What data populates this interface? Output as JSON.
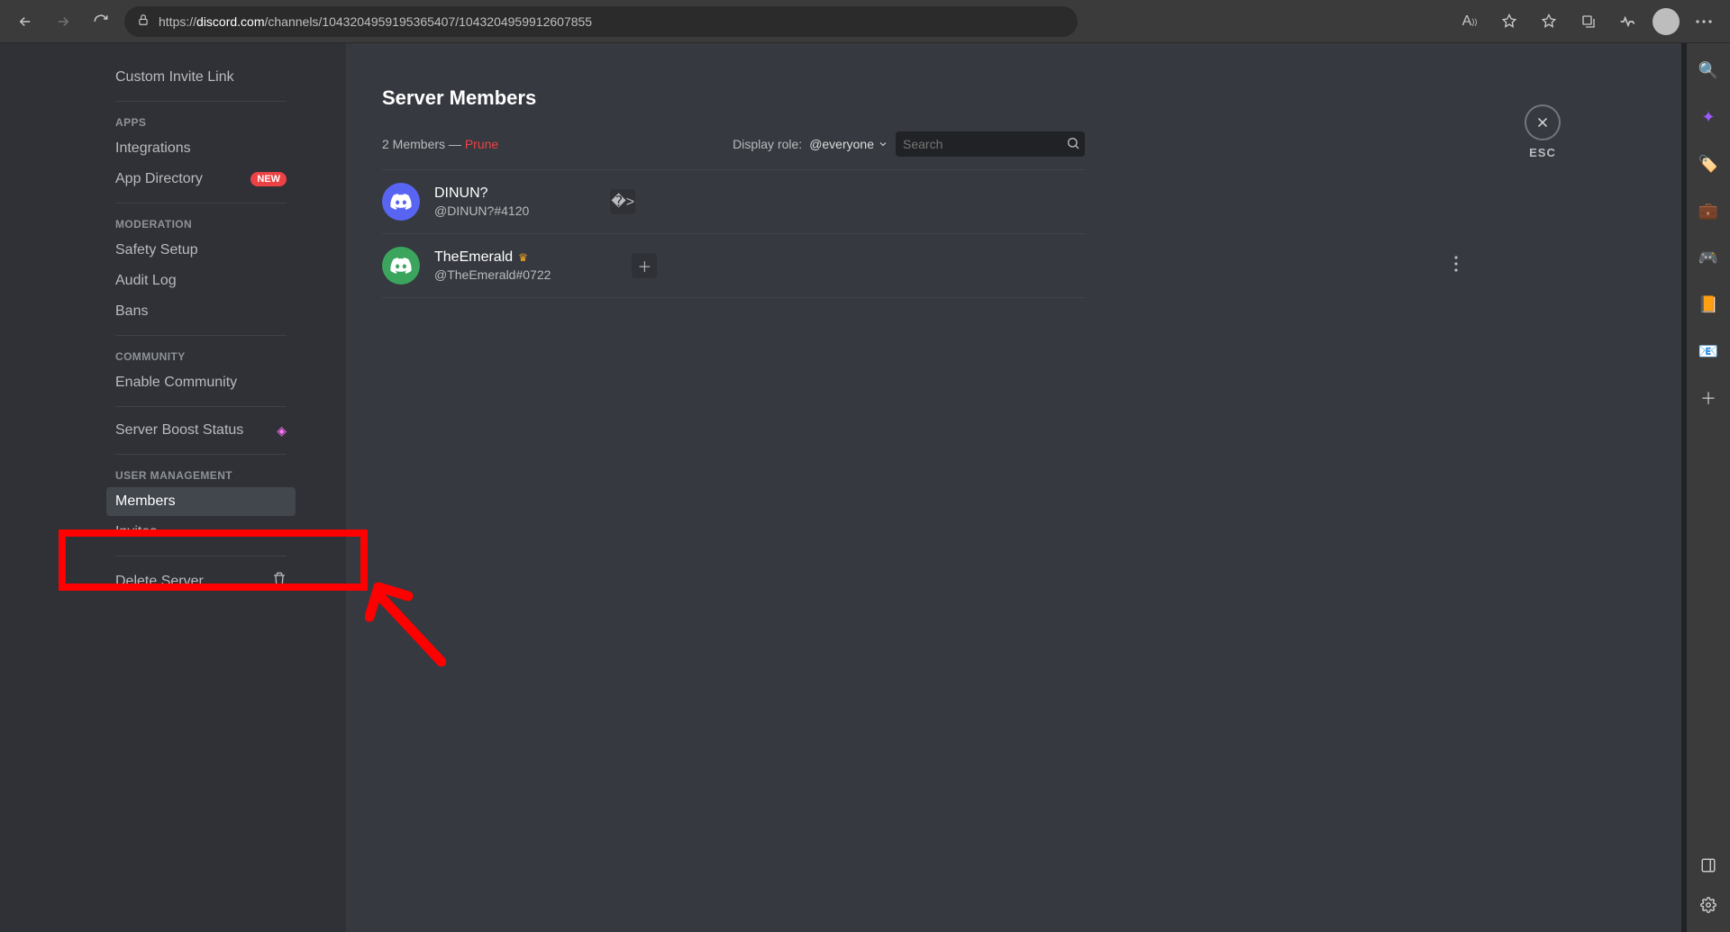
{
  "browser": {
    "url_prefix": "https://",
    "url_domain": "discord.com",
    "url_path": "/channels/1043204959195365407/1043204959912607855"
  },
  "sidebar": {
    "custom_invite": "Custom Invite Link",
    "section_apps": "APPS",
    "integrations": "Integrations",
    "app_directory": "App Directory",
    "new_badge": "NEW",
    "section_moderation": "MODERATION",
    "safety_setup": "Safety Setup",
    "audit_log": "Audit Log",
    "bans": "Bans",
    "section_community": "COMMUNITY",
    "enable_community": "Enable Community",
    "boost_status": "Server Boost Status",
    "section_user_mgmt": "USER MANAGEMENT",
    "members": "Members",
    "invites": "Invites",
    "delete_server": "Delete Server"
  },
  "content": {
    "title": "Server Members",
    "count_text": "2 Members —",
    "prune": "Prune",
    "display_role_label": "Display role:",
    "role_selected": "@everyone",
    "search_placeholder": "Search",
    "esc": "ESC"
  },
  "members": [
    {
      "name": "DINUN?",
      "tag": "@DINUN?#4120",
      "owner": false,
      "avatar_color": "blurple"
    },
    {
      "name": "TheEmerald",
      "tag": "@TheEmerald#0722",
      "owner": true,
      "avatar_color": "green"
    }
  ]
}
